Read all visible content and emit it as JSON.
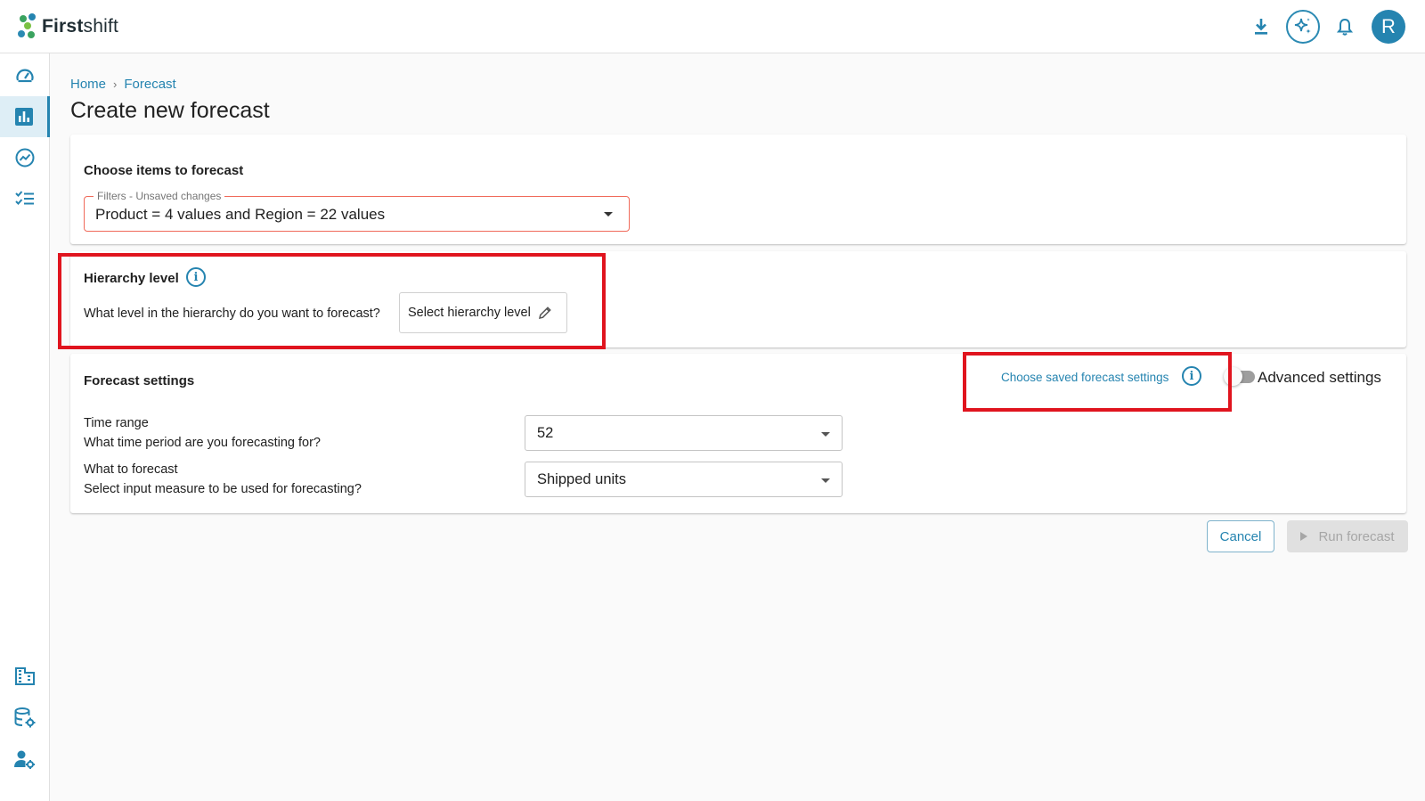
{
  "app": {
    "logo_bold": "First",
    "logo_light": "shift",
    "brand_color": "#2584b0",
    "avatar_initial": "R"
  },
  "header_icons": [
    "download-icon",
    "ai-sparkle-icon",
    "bell-icon",
    "avatar"
  ],
  "sidebar": {
    "items": [
      {
        "name": "dashboard-icon",
        "active": false
      },
      {
        "name": "forecast-chart-icon",
        "active": true
      },
      {
        "name": "trend-icon",
        "active": false
      },
      {
        "name": "checklist-icon",
        "active": false
      },
      {
        "name": "organization-icon",
        "active": false
      },
      {
        "name": "database-settings-icon",
        "active": false
      },
      {
        "name": "user-settings-icon",
        "active": false
      }
    ]
  },
  "breadcrumb": {
    "home": "Home",
    "separator": "›",
    "current": "Forecast"
  },
  "page_title": "Create new forecast",
  "items_card": {
    "title": "Choose items to forecast",
    "filter_legend": "Filters - Unsaved changes",
    "filter_value": "Product = 4 values and Region = 22 values"
  },
  "hierarchy_card": {
    "title": "Hierarchy level",
    "question": "What level in the hierarchy do you want to forecast?",
    "button_label": "Select hierarchy level"
  },
  "settings_card": {
    "title": "Forecast settings",
    "saved_link": "Choose saved forecast settings",
    "advanced_label": "Advanced settings",
    "advanced_enabled": false,
    "time_range_label": "Time range",
    "time_range_question": "What time period are you forecasting for?",
    "time_range_value": "52",
    "measure_label": "What to forecast",
    "measure_question": "Select input measure to be used for forecasting?",
    "measure_value": "Shipped units"
  },
  "actions": {
    "cancel": "Cancel",
    "run": "Run forecast"
  },
  "colors": {
    "highlight": "#e0141e",
    "filter_border": "#f06a5a"
  }
}
